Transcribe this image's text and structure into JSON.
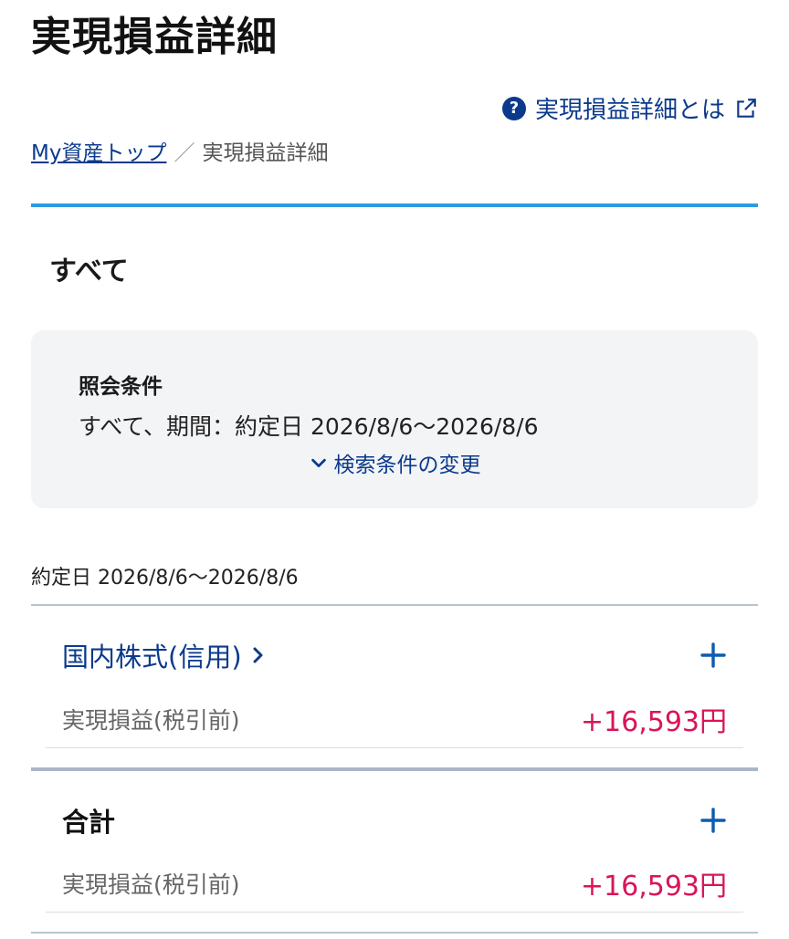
{
  "page": {
    "title": "実現損益詳細"
  },
  "help": {
    "icon": "question-circle-icon",
    "label": "実現損益詳細とは",
    "external_icon": "external-link-icon"
  },
  "breadcrumb": {
    "items": [
      {
        "label": "My資産トップ",
        "link": true
      },
      {
        "label": "実現損益詳細",
        "link": false
      }
    ],
    "separator": "／"
  },
  "filter": {
    "section_label": "すべて",
    "condition_title": "照会条件",
    "condition_text": "すべて、期間：約定日 2026/8/6〜2026/8/6",
    "change_label": "検索条件の変更"
  },
  "results": {
    "date_range": "約定日 2026/8/6〜2026/8/6",
    "rows": [
      {
        "category": "国内株式(信用)",
        "metric_label": "実現損益(税引前)",
        "metric_value": "+16,593円"
      },
      {
        "category": "合計",
        "metric_label": "実現損益(税引前)",
        "metric_value": "+16,593円"
      }
    ]
  },
  "colors": {
    "accent_blue": "#2f9ae0",
    "link_blue": "#0b3a8c",
    "profit_red": "#d9145a"
  }
}
